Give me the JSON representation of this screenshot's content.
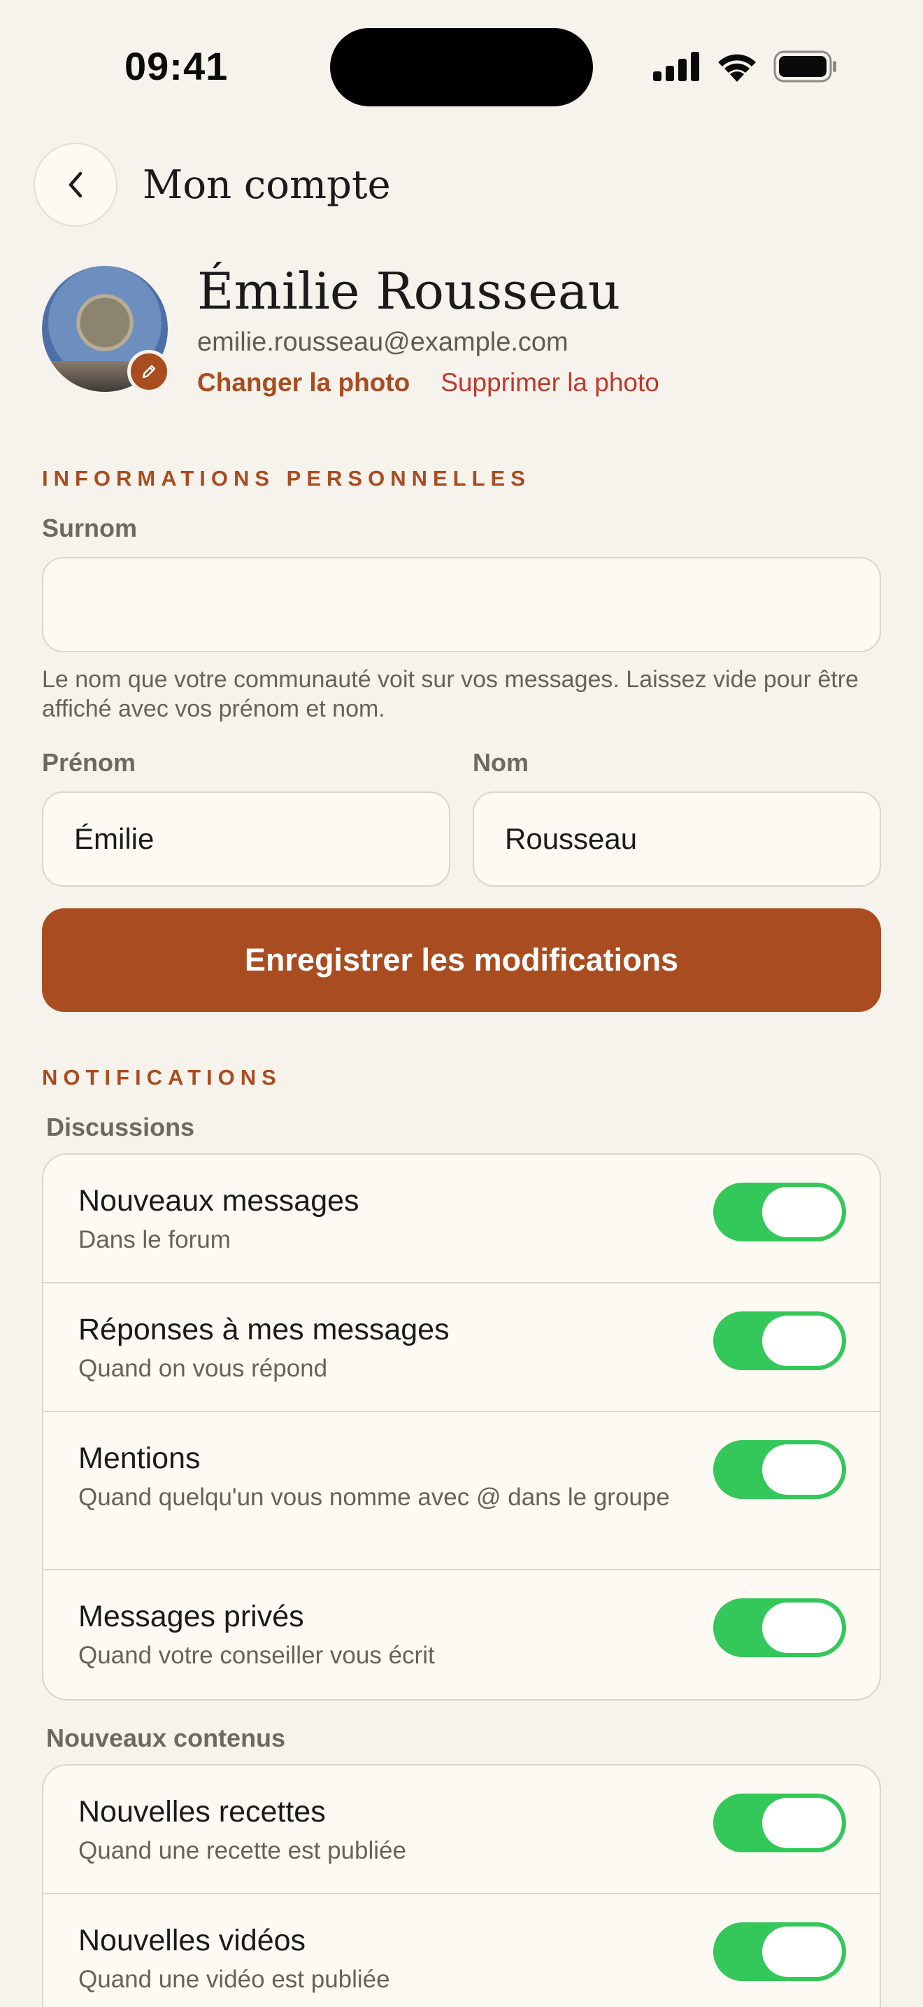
{
  "status_bar": {
    "time": "09:41"
  },
  "header": {
    "title": "Mon compte"
  },
  "profile": {
    "name": "Émilie Rousseau",
    "email": "emilie.rousseau@example.com",
    "change_photo": "Changer la photo",
    "delete_photo": "Supprimer la photo"
  },
  "personal": {
    "heading": "INFORMATIONS PERSONNELLES",
    "nickname_label": "Surnom",
    "nickname_value": "",
    "nickname_hint": "Le nom que votre communauté voit sur vos messages. Laissez vide pour être affiché avec vos prénom et nom.",
    "first_name_label": "Prénom",
    "first_name_value": "Émilie",
    "last_name_label": "Nom",
    "last_name_value": "Rousseau",
    "save_label": "Enregistrer les modifications"
  },
  "notifications": {
    "heading": "NOTIFICATIONS",
    "discussions_label": "Discussions",
    "discussions": [
      {
        "title": "Nouveaux messages",
        "subtitle": "Dans le forum",
        "enabled": true
      },
      {
        "title": "Réponses à mes messages",
        "subtitle": "Quand on vous répond",
        "enabled": true
      },
      {
        "title": "Mentions",
        "subtitle": "Quand quelqu'un vous nomme avec @ dans le groupe",
        "enabled": true
      },
      {
        "title": "Messages privés",
        "subtitle": "Quand votre conseiller vous écrit",
        "enabled": true
      }
    ],
    "content_label": "Nouveaux contenus",
    "content": [
      {
        "title": "Nouvelles recettes",
        "subtitle": "Quand une recette est publiée",
        "enabled": true
      },
      {
        "title": "Nouvelles vidéos",
        "subtitle": "Quand une vidéo est publiée",
        "enabled": true
      }
    ]
  },
  "colors": {
    "accent": "#A94C20",
    "danger": "#C2372C",
    "toggle_on": "#34C759",
    "background": "#F6F2EC"
  }
}
